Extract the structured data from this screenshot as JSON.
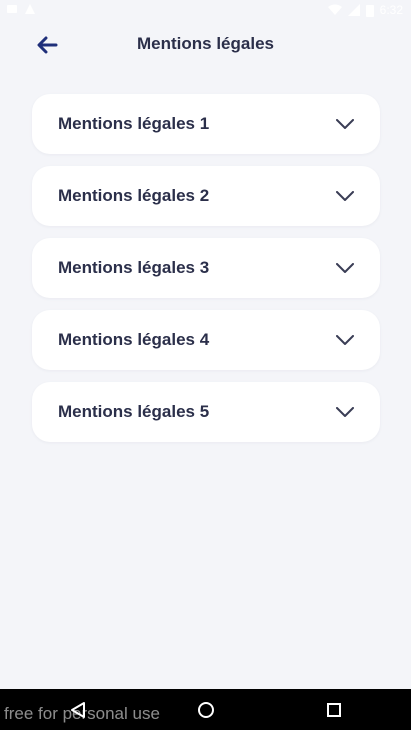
{
  "status_bar": {
    "time": "6:32"
  },
  "header": {
    "title": "Mentions légales",
    "back_icon": "arrow-left-icon"
  },
  "accordion": {
    "items": [
      {
        "label": "Mentions légales 1"
      },
      {
        "label": "Mentions légales 2"
      },
      {
        "label": "Mentions légales 3"
      },
      {
        "label": "Mentions légales 4"
      },
      {
        "label": "Mentions légales 5"
      }
    ],
    "chevron_icon": "chevron-down-icon"
  },
  "system_nav": {
    "watermark": "free for personal use"
  },
  "colors": {
    "accent": "#1f2f7a",
    "text": "#2b2f4a",
    "background": "#f4f5f9",
    "card": "#ffffff"
  }
}
